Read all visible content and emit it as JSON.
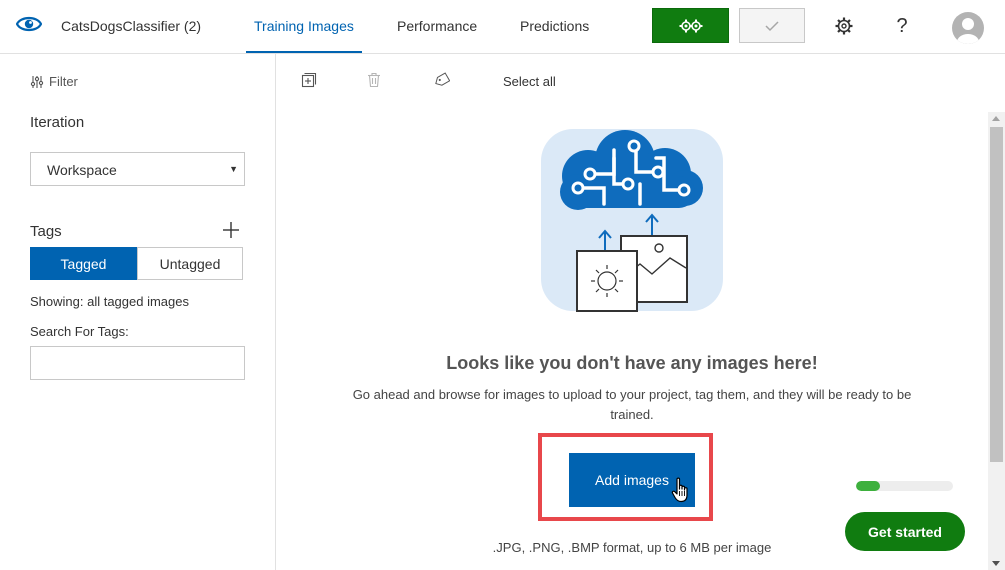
{
  "header": {
    "project_name": "CatsDogsClassifier (2)",
    "tabs": [
      {
        "label": "Training Images",
        "active": true
      },
      {
        "label": "Performance",
        "active": false
      },
      {
        "label": "Predictions",
        "active": false
      }
    ],
    "train_icon": "gears-icon",
    "quick_test_icon": "checkmark-icon",
    "help_label": "?"
  },
  "sidebar": {
    "filter_label": "Filter",
    "iteration_title": "Iteration",
    "iteration_value": "Workspace",
    "tags_title": "Tags",
    "tag_toggle": {
      "tagged": "Tagged",
      "untagged": "Untagged"
    },
    "showing_text": "Showing: all tagged images",
    "search_label": "Search For Tags:",
    "search_value": ""
  },
  "toolbar": {
    "select_all": "Select all"
  },
  "empty_state": {
    "title": "Looks like you don't have any images here!",
    "description": "Go ahead and browse for images to upload to your project, tag them, and they will be ready to be trained.",
    "add_images_label": "Add images",
    "formats": ".JPG, .PNG, .BMP format, up to 6 MB per image"
  },
  "onboarding": {
    "progress_fraction": 0.25,
    "get_started_label": "Get started"
  },
  "colors": {
    "accent_blue": "#0063b1",
    "train_green": "#107c10",
    "highlight_red": "#e8474b"
  }
}
